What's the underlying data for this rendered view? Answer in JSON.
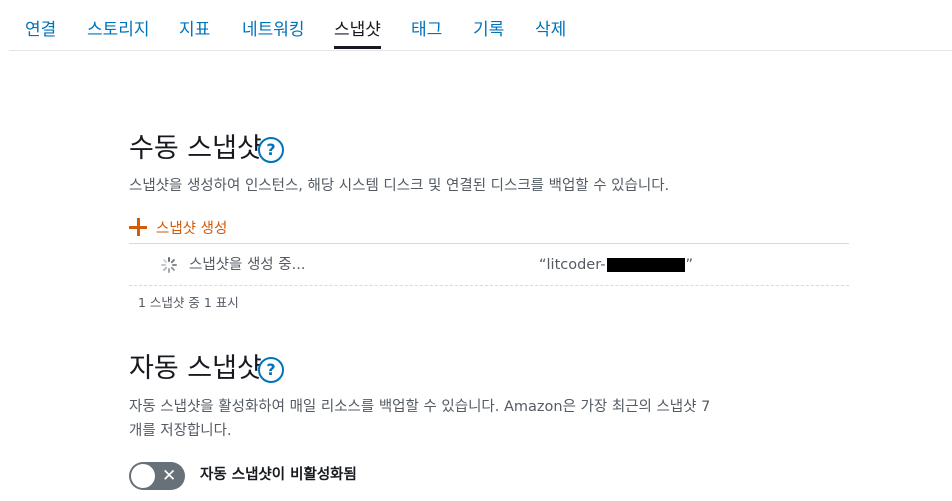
{
  "tabs": [
    {
      "label": "연결",
      "active": false
    },
    {
      "label": "스토리지",
      "active": false
    },
    {
      "label": "지표",
      "active": false
    },
    {
      "label": "네트워킹",
      "active": false
    },
    {
      "label": "스냅샷",
      "active": true
    },
    {
      "label": "태그",
      "active": false
    },
    {
      "label": "기록",
      "active": false
    },
    {
      "label": "삭제",
      "active": false
    }
  ],
  "manual": {
    "title": "수동 스냅샷",
    "help_glyph": "?",
    "description": "스냅샷을 생성하여 인스턴스, 해당 시스템 디스크 및 연결된 디스크를 백업할 수 있습니다.",
    "create_label": "스냅샷 생성",
    "row": {
      "status": "스냅샷을 생성 중...",
      "name_prefix": "“litcoder-",
      "name_suffix": "”"
    },
    "count_text": "1 스냅샷 중 1 표시"
  },
  "automatic": {
    "title": "자동 스냅샷",
    "help_glyph": "?",
    "description_line1": "자동 스냅샷을 활성화하여 매일 리소스를 백업할 수 있습니다. Amazon은 가장 최근의 스냅샷 7",
    "description_line2": "개를 저장합니다.",
    "toggle_label": "자동 스냅샷이 비활성화됨",
    "toggle_enabled": false
  },
  "colors": {
    "link": "#0073bb",
    "accent": "#d45b07",
    "toggle_off": "#687078"
  },
  "icons": {
    "help": "help-icon",
    "plus": "plus-icon",
    "spinner": "loading-spinner-icon",
    "toggle_x": "close-icon"
  }
}
